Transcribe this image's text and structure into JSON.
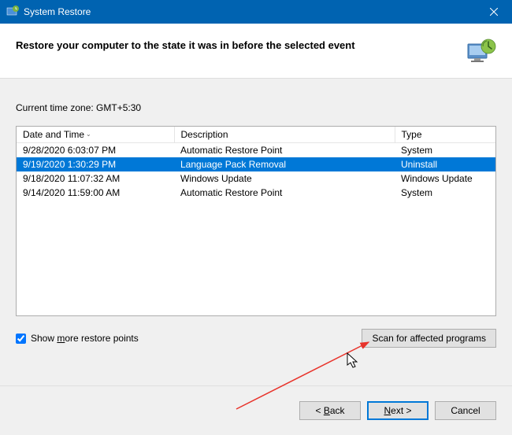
{
  "titlebar": {
    "title": "System Restore"
  },
  "header": {
    "text": "Restore your computer to the state it was in before the selected event"
  },
  "timezone": {
    "label": "Current time zone: GMT+5:30"
  },
  "table": {
    "columns": {
      "date": "Date and Time",
      "description": "Description",
      "type": "Type"
    },
    "rows": [
      {
        "date": "9/28/2020 6:03:07 PM",
        "description": "Automatic Restore Point",
        "type": "System",
        "selected": false
      },
      {
        "date": "9/19/2020 1:30:29 PM",
        "description": "Language Pack Removal",
        "type": "Uninstall",
        "selected": true
      },
      {
        "date": "9/18/2020 11:07:32 AM",
        "description": "Windows Update",
        "type": "Windows Update",
        "selected": false
      },
      {
        "date": "9/14/2020 11:59:00 AM",
        "description": "Automatic Restore Point",
        "type": "System",
        "selected": false
      }
    ]
  },
  "options": {
    "show_more_label_pre": "Show ",
    "show_more_label_u": "m",
    "show_more_label_post": "ore restore points",
    "show_more_checked": true,
    "scan_button": "Scan for affected programs"
  },
  "footer": {
    "back_pre": "< ",
    "back_u": "B",
    "back_post": "ack",
    "next_u": "N",
    "next_post": "ext >",
    "cancel": "Cancel"
  }
}
